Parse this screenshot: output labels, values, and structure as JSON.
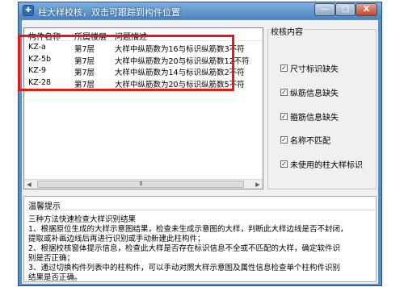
{
  "window": {
    "title": "柱大样校核，双击可跟踪到构件位置",
    "minimize_label": "—",
    "maximize_label": "□",
    "close_label": "X"
  },
  "list": {
    "headers": [
      "构件名称",
      "所属楼层",
      "问题描述"
    ],
    "rows": [
      {
        "name": "KZ-a",
        "floor": "第7层",
        "desc": "大样中纵筋数为16与标识纵筋数3不符"
      },
      {
        "name": "KZ-5b",
        "floor": "第7层",
        "desc": "大样中纵筋数为20与标识纵筋数12不符"
      },
      {
        "name": "KZ-9",
        "floor": "第7层",
        "desc": "大样中纵筋数为14与标识纵筋数2不符"
      },
      {
        "name": "KZ-28",
        "floor": "第7层",
        "desc": "大样中纵筋数为20与标识纵筋数5不符"
      }
    ],
    "scroll_left": "◀",
    "scroll_right": "▶",
    "scroll_grip": "III",
    "highlight_color": "#e01919"
  },
  "check_panel": {
    "title": "校核内容",
    "items": [
      {
        "label": "尺寸标识缺失",
        "checked": true
      },
      {
        "label": "纵筋信息缺失",
        "checked": true
      },
      {
        "label": "箍筋信息缺失",
        "checked": true
      },
      {
        "label": "名称不匹配",
        "checked": true
      },
      {
        "label": "未使用的柱大样标识",
        "checked": true
      }
    ],
    "check_mark": "✓"
  },
  "hint": {
    "title": "温馨提示",
    "lines": [
      "三种方法快速检查大样识别结果",
      "1、根据原位生成的大样示意图结果，检查未生成示意图的大样，判断此大样边线是否不封闭，",
      "   提取或补画边线后再进行识别或手动新建此柱构件；",
      "2、根据校核窗体提示信息，检查此大样是否存在标识信息不全或不匹配的大样，确定软件识",
      "   别是否正确；",
      "3、通过切换构件列表中的柱构件，可以手动对照大样示意图及属性信息检查单个柱构件识别",
      "   结果是否正确。"
    ]
  },
  "colors": {
    "title_bar": "#5a8ec3",
    "close_button": "#c2452c"
  }
}
